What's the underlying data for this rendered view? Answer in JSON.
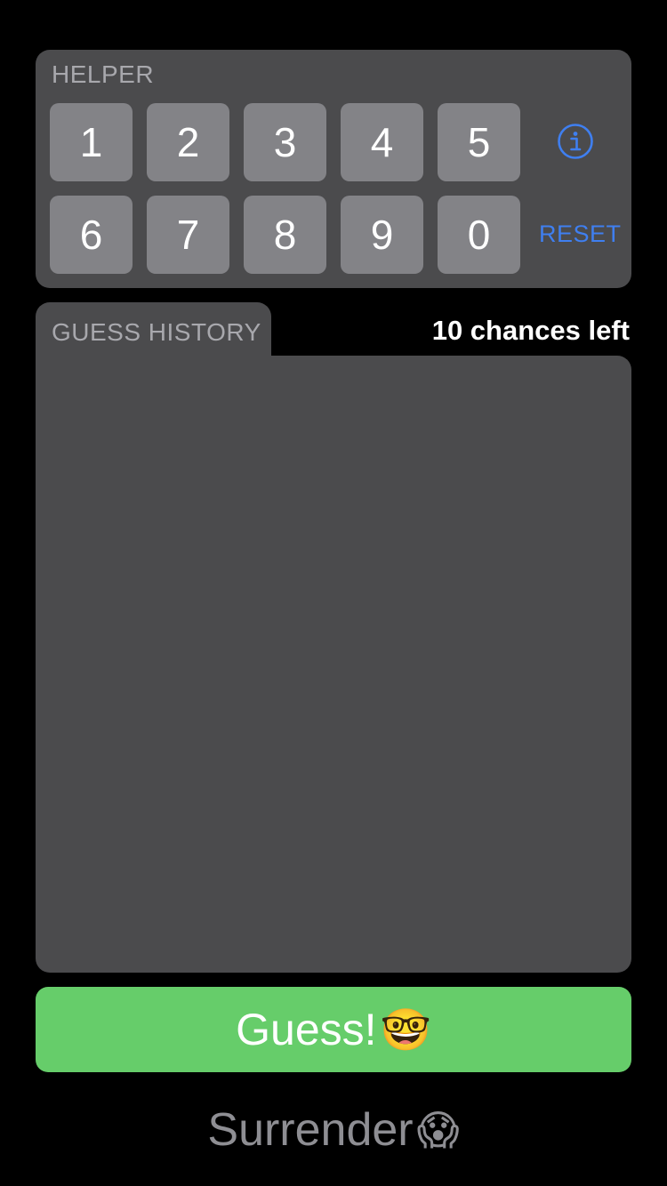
{
  "helper": {
    "label": "HELPER",
    "row1": [
      "1",
      "2",
      "3",
      "4",
      "5"
    ],
    "row2": [
      "6",
      "7",
      "8",
      "9",
      "0"
    ],
    "info_icon": "info-circle-icon",
    "reset_label": "RESET"
  },
  "history": {
    "tab_label": "GUESS HISTORY",
    "chances_text": "10 chances left"
  },
  "actions": {
    "guess_label": "Guess!",
    "guess_emoji": "🤓",
    "surrender_label": "Surrender",
    "surrender_emoji": "😱"
  },
  "colors": {
    "background": "#000000",
    "panel": "#4b4b4d",
    "key": "#838387",
    "accent_blue": "#3f7ff0",
    "guess_green": "#66cd6a",
    "muted_text": "#a8a8ad"
  }
}
